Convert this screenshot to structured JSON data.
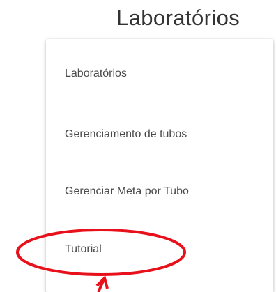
{
  "header": {
    "title": "Laboratórios"
  },
  "menu": {
    "items": [
      {
        "label": "Laboratórios"
      },
      {
        "label": "Gerenciamento de tubos"
      },
      {
        "label": "Gerenciar Meta por Tubo"
      },
      {
        "label": "Tutorial"
      }
    ]
  },
  "annotation": {
    "color": "#e8101a",
    "highlighted_item": "Tutorial",
    "shapes": [
      "highlight-ellipse",
      "pointer-arrow"
    ]
  }
}
